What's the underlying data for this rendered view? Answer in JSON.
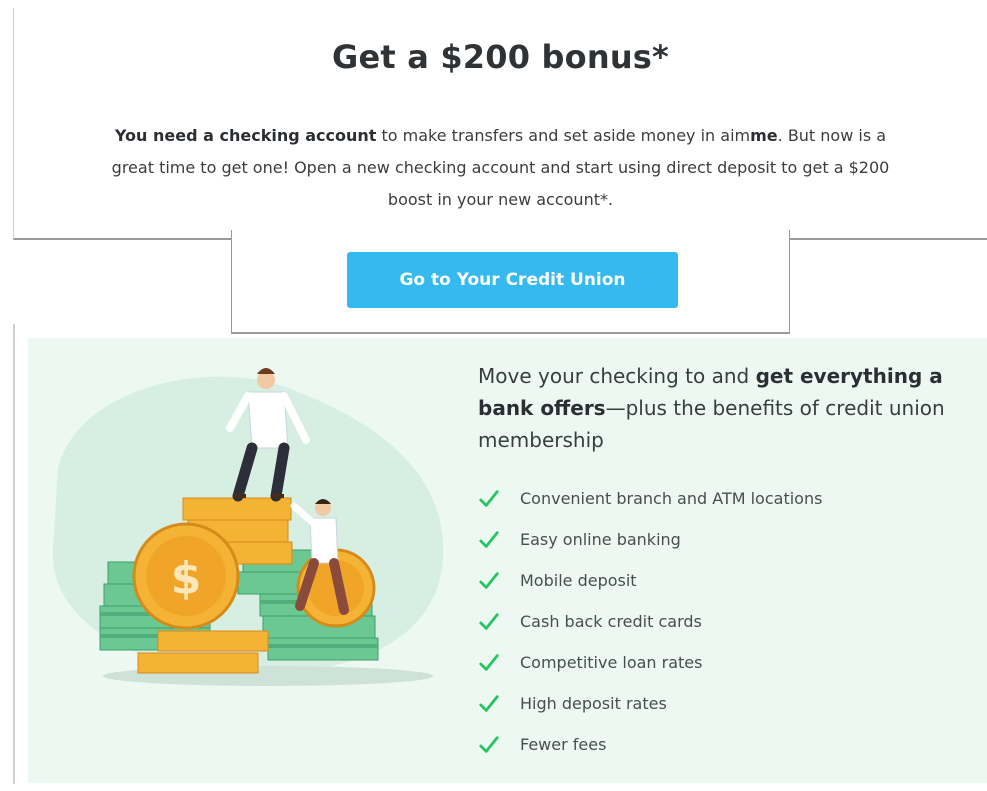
{
  "offer": {
    "headline": "Get a $200 bonus*",
    "intro_bold": "You need a checking account",
    "intro_part1": " to make transfers and set aside money in aim",
    "intro_brand_bold": "me",
    "intro_part2": ". But now is a great time to get one! Open a new checking account and start using direct deposit to get a $200 boost in your new account*."
  },
  "cta": {
    "label": "Go to Your Credit Union"
  },
  "benefits": {
    "heading_part1": "Move your checking to and ",
    "heading_bold": "get everything a bank offers",
    "heading_part2": "—plus the benefits of credit union membership",
    "check_icon": "checkmark-icon",
    "check_color": "#22c55e",
    "items": [
      "Convenient branch and ATM locations",
      "Easy online banking",
      "Mobile deposit",
      "Cash back credit cards",
      "Competitive loan rates",
      "High deposit rates",
      "Fewer fees"
    ]
  },
  "colors": {
    "accent": "#35b9ee",
    "panel_bg": "#edf8f3",
    "money_green": "#59c38a",
    "coin_gold": "#f5b336"
  }
}
